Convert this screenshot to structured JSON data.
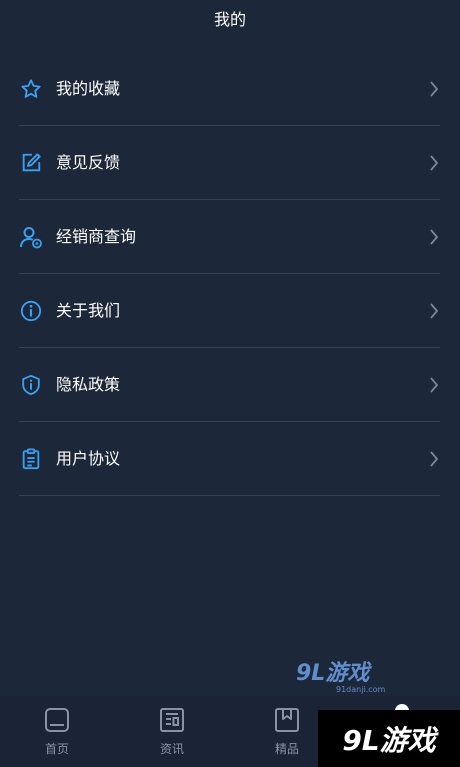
{
  "header": {
    "title": "我的"
  },
  "menu": [
    {
      "label": "我的收藏",
      "icon": "star-icon"
    },
    {
      "label": "意见反馈",
      "icon": "edit-icon"
    },
    {
      "label": "经销商查询",
      "icon": "dealer-user-icon"
    },
    {
      "label": "关于我们",
      "icon": "info-icon"
    },
    {
      "label": "隐私政策",
      "icon": "shield-icon"
    },
    {
      "label": "用户协议",
      "icon": "document-icon"
    }
  ],
  "tabs": [
    {
      "label": "首页",
      "icon": "home-icon"
    },
    {
      "label": "资讯",
      "icon": "news-icon"
    },
    {
      "label": "精品",
      "icon": "bookmark-icon"
    }
  ],
  "watermark": {
    "main": "9L游戏",
    "sub": "91danji.com"
  },
  "badge": {
    "text": "9L游戏"
  },
  "colors": {
    "accent": "#3aa0f0",
    "background": "#1d273a",
    "divider": "#34415a",
    "tab_text": "#8a93a4"
  }
}
